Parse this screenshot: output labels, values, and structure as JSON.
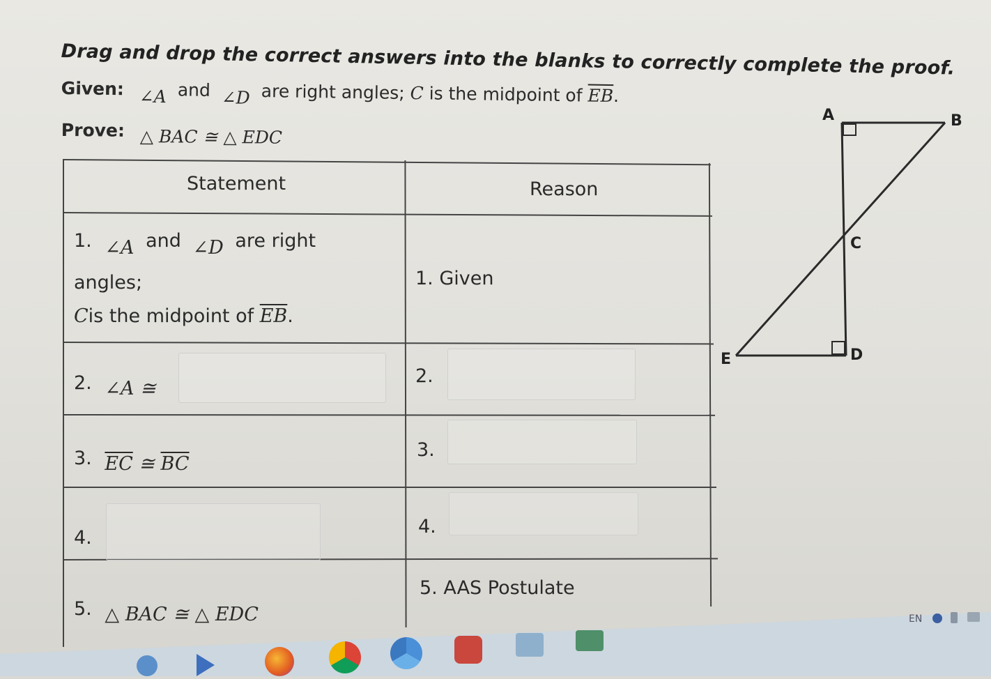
{
  "instructions": "Drag and drop the correct answers into the blanks to correctly complete the proof.",
  "given": {
    "label": "Given:",
    "angle_a": "∠A",
    "and": "and",
    "angle_d": "∠D",
    "rest": "are right angles; ",
    "c": "C",
    "midpoint": "is the midpoint of ",
    "segment": "EB",
    "period": "."
  },
  "prove": {
    "label": "Prove:",
    "statement": "△ BAC ≅ △ EDC"
  },
  "table": {
    "headers": {
      "statement": "Statement",
      "reason": "Reason"
    },
    "rows": [
      {
        "number": "1.",
        "line1_angle_a": "∠A",
        "line1_and": "and",
        "line1_angle_d": "∠D",
        "line1_rest": "are right",
        "line2": "angles;",
        "line3_c": "C",
        "line3_text": "is the midpoint of ",
        "line3_segment": "EB",
        "line3_period": ".",
        "reason": "1. Given"
      },
      {
        "number": "2.",
        "statement": "∠A ≅",
        "reason": "2."
      },
      {
        "number": "3.",
        "seg1": "EC",
        "cong": " ≅ ",
        "seg2": "BC",
        "reason": "3."
      },
      {
        "number": "4.",
        "reason": "4."
      },
      {
        "number": "5.",
        "statement": "△ BAC ≅ △ EDC",
        "reason": "5. AAS Postulate"
      }
    ]
  },
  "figure": {
    "labels": {
      "a": "A",
      "b": "B",
      "c": "C",
      "d": "D",
      "e": "E"
    }
  },
  "taskbar": {
    "language": "EN"
  },
  "colors": {
    "background": "#e6e5e0",
    "table_line": "#444444",
    "text": "#222222",
    "taskbar": "#cfd9e2"
  }
}
